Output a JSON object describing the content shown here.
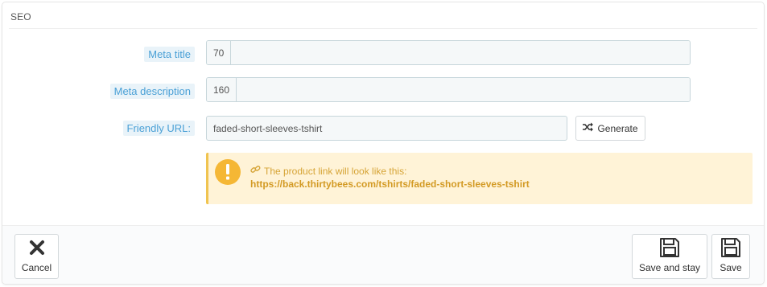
{
  "panel": {
    "title": "SEO"
  },
  "fields": {
    "meta_title": {
      "label": "Meta title",
      "counter": "70",
      "value": ""
    },
    "meta_description": {
      "label": "Meta description",
      "counter": "160",
      "value": ""
    },
    "friendly_url": {
      "label": "Friendly URL:",
      "value": "faded-short-sleeves-tshirt"
    }
  },
  "generate_button": {
    "label": "Generate",
    "icon": "shuffle-icon"
  },
  "alert": {
    "icon": "exclamation-icon",
    "message": "The product link will look like this:",
    "link": "https://back.thirtybees.com/tshirts/faded-short-sleeves-tshirt",
    "colors": {
      "background": "#fff3d7",
      "text": "#d39a24"
    }
  },
  "footer": {
    "cancel_label": "Cancel",
    "save_and_stay_label": "Save and stay",
    "save_label": "Save"
  },
  "colors": {
    "label_bg": "#e9f3f9",
    "label_text": "#4aa0d6"
  }
}
